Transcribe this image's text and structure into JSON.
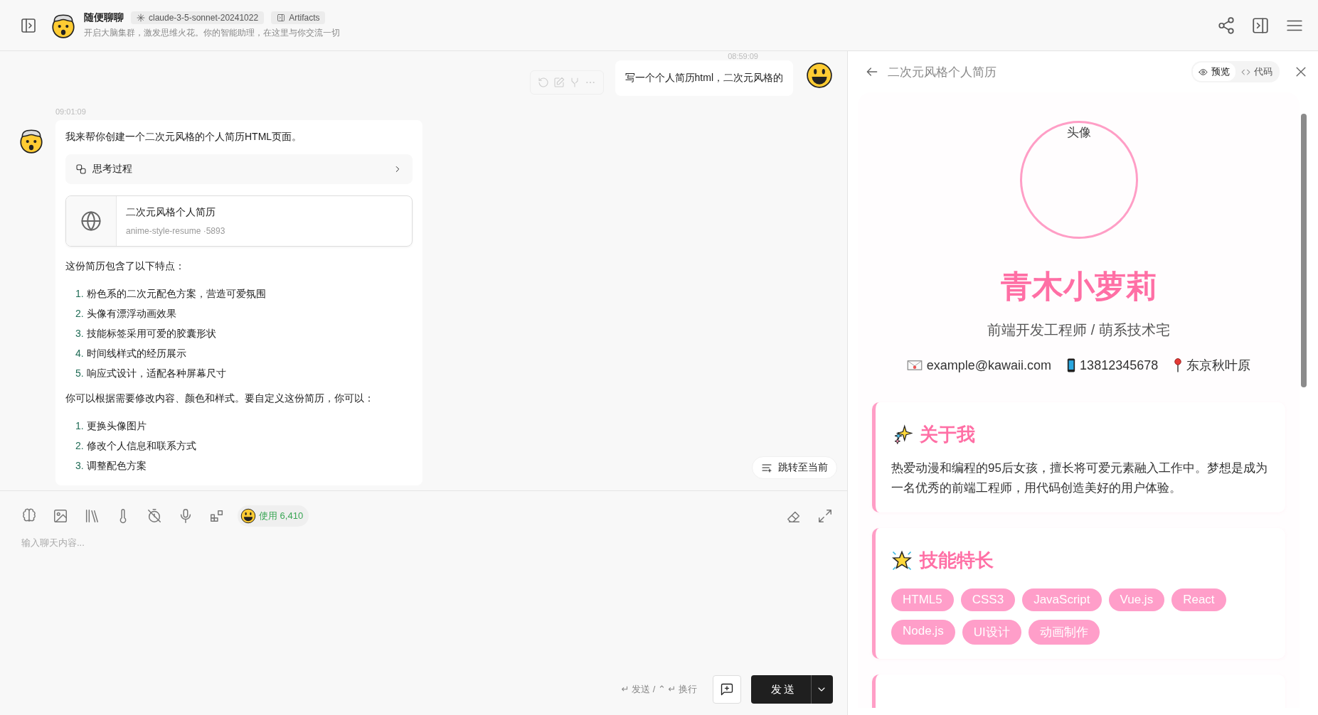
{
  "header": {
    "title": "随便聊聊",
    "model": "claude-3-5-sonnet-20241022",
    "tag": "Artifacts",
    "subtitle": "开启大脑集群，激发思维火花。你的智能助理，在这里与你交流一切"
  },
  "messages": [
    {
      "kind": "user",
      "time": "08:59:09",
      "text": "写一个个人简历html，二次元风格的"
    },
    {
      "kind": "assistant",
      "time": "09:01:09",
      "blocks": [
        {
          "kind": "text",
          "text": "我来帮你创建一个二次元风格的个人简历HTML页面。"
        },
        {
          "kind": "thinking",
          "text": "思考过程"
        },
        {
          "kind": "artifact",
          "title": "二次元风格个人简历",
          "subtitle": "anime-style-resume ·5893"
        },
        {
          "kind": "text",
          "text": "这份简历包含了以下特点："
        },
        {
          "kind": "list",
          "items": [
            {
              "number": "1.",
              "text": "粉色系的二次元配色方案，营造可爱氛围"
            },
            {
              "number": "2.",
              "text": "头像有漂浮动画效果"
            },
            {
              "number": "3.",
              "text": "技能标签采用可爱的胶囊形状"
            },
            {
              "number": "4.",
              "text": "时间线样式的经历展示"
            },
            {
              "number": "5.",
              "text": "响应式设计，适配各种屏幕尺寸"
            }
          ]
        },
        {
          "kind": "text",
          "text": "你可以根据需要修改内容、颜色和样式。要自定义这份简历，你可以："
        },
        {
          "kind": "list",
          "items": [
            {
              "number": "1.",
              "text": "更换头像图片"
            },
            {
              "number": "2.",
              "text": "修改个人信息和联系方式"
            },
            {
              "number": "3.",
              "text": "调整配色方案"
            }
          ]
        }
      ]
    }
  ],
  "jump_button": "跳转至当前",
  "composer": {
    "usage": "使用 6,410",
    "placeholder": "输入聊天内容...",
    "hint": "↵ 发送 / ⌃ ↵ 换行",
    "send": "发送"
  },
  "preview": {
    "title": "二次元风格个人简历",
    "tabs": [
      {
        "label": "预览",
        "selected": true
      },
      {
        "label": "代码",
        "selected": false
      }
    ],
    "resume": {
      "avatar_label": "头像",
      "name": "青木小萝莉",
      "role": "前端开发工程师 / 萌系技术宅",
      "contacts": [
        {
          "kind": "email",
          "text": "example@kawaii.com"
        },
        {
          "kind": "phone",
          "text": "13812345678"
        },
        {
          "kind": "location",
          "text": "东京秋叶原"
        }
      ],
      "sections": [
        {
          "kind": "about",
          "title": "关于我",
          "text": "热爱动漫和编程的95后女孩，擅长将可爱元素融入工作中。梦想是成为一名优秀的前端工程师，用代码创造美好的用户体验。"
        },
        {
          "kind": "skills",
          "title": "技能特长",
          "tags": [
            "HTML5",
            "CSS3",
            "JavaScript",
            "Vue.js",
            "React",
            "Node.js",
            "UI设计",
            "动画制作"
          ]
        },
        {
          "kind": "empty"
        }
      ]
    }
  }
}
